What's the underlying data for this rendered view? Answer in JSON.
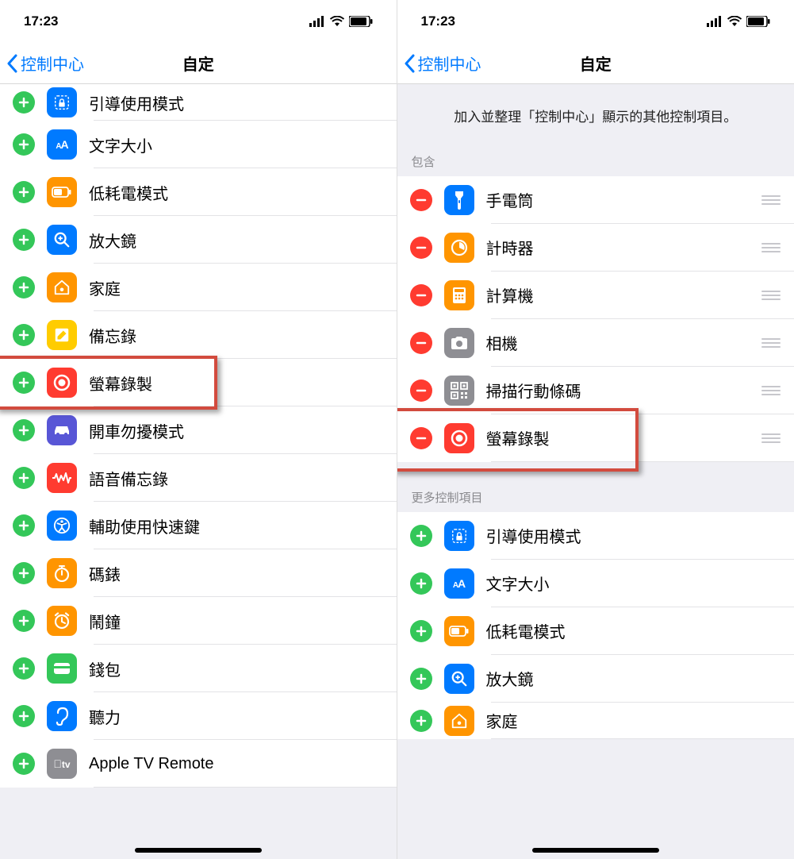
{
  "status": {
    "time": "17:23"
  },
  "nav": {
    "back": "控制中心",
    "title": "自定"
  },
  "left": {
    "items": [
      {
        "name": "guided-access",
        "label": "引導使用模式",
        "icon": "lock-dashed",
        "color": "#007aff",
        "partial": true
      },
      {
        "name": "text-size",
        "label": "文字大小",
        "icon": "aa",
        "color": "#007aff"
      },
      {
        "name": "low-power",
        "label": "低耗電模式",
        "icon": "battery",
        "color": "#ff9500"
      },
      {
        "name": "magnifier",
        "label": "放大鏡",
        "icon": "search-plus",
        "color": "#007aff"
      },
      {
        "name": "home",
        "label": "家庭",
        "icon": "home",
        "color": "#ff9500"
      },
      {
        "name": "notes",
        "label": "備忘錄",
        "icon": "note",
        "color": "#ffcc00"
      },
      {
        "name": "screen-recording",
        "label": "螢幕錄製",
        "icon": "record",
        "color": "#ff3b30",
        "highlight": true
      },
      {
        "name": "do-not-disturb-driving",
        "label": "開車勿擾模式",
        "icon": "car",
        "color": "#5856d6"
      },
      {
        "name": "voice-memos",
        "label": "語音備忘錄",
        "icon": "wave",
        "color": "#ff3b30"
      },
      {
        "name": "accessibility-shortcut",
        "label": "輔助使用快速鍵",
        "icon": "accessibility",
        "color": "#007aff"
      },
      {
        "name": "stopwatch",
        "label": "碼錶",
        "icon": "stopwatch",
        "color": "#ff9500"
      },
      {
        "name": "alarm",
        "label": "鬧鐘",
        "icon": "alarm",
        "color": "#ff9500"
      },
      {
        "name": "wallet",
        "label": "錢包",
        "icon": "wallet",
        "color": "#34c759"
      },
      {
        "name": "hearing",
        "label": "聽力",
        "icon": "ear",
        "color": "#007aff"
      },
      {
        "name": "apple-tv-remote",
        "label": "Apple TV Remote",
        "icon": "appletv",
        "color": "#8e8e93"
      }
    ]
  },
  "right": {
    "description": "加入並整理「控制中心」顯示的其他控制項目。",
    "included_header": "包含",
    "more_header": "更多控制項目",
    "included": [
      {
        "name": "flashlight",
        "label": "手電筒",
        "icon": "flashlight",
        "color": "#007aff"
      },
      {
        "name": "timer",
        "label": "計時器",
        "icon": "timer",
        "color": "#ff9500"
      },
      {
        "name": "calculator",
        "label": "計算機",
        "icon": "calculator",
        "color": "#ff9500"
      },
      {
        "name": "camera",
        "label": "相機",
        "icon": "camera",
        "color": "#8e8e93"
      },
      {
        "name": "qr-scanner",
        "label": "掃描行動條碼",
        "icon": "qr",
        "color": "#8e8e93"
      },
      {
        "name": "screen-recording",
        "label": "螢幕錄製",
        "icon": "record",
        "color": "#ff3b30",
        "highlight": true
      }
    ],
    "more": [
      {
        "name": "guided-access",
        "label": "引導使用模式",
        "icon": "lock-dashed",
        "color": "#007aff"
      },
      {
        "name": "text-size",
        "label": "文字大小",
        "icon": "aa",
        "color": "#007aff"
      },
      {
        "name": "low-power",
        "label": "低耗電模式",
        "icon": "battery",
        "color": "#ff9500"
      },
      {
        "name": "magnifier",
        "label": "放大鏡",
        "icon": "search-plus",
        "color": "#007aff"
      },
      {
        "name": "home",
        "label": "家庭",
        "icon": "home",
        "color": "#ff9500",
        "partial": true
      }
    ]
  }
}
